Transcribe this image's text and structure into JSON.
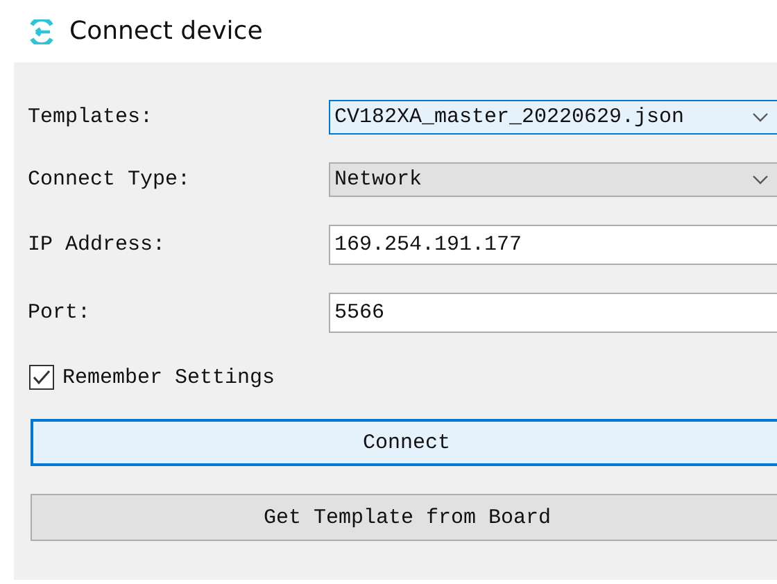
{
  "window": {
    "title": "Connect device"
  },
  "fields": [
    {
      "label": "Templates:",
      "kind": "combo",
      "value": "CV182XA_master_20220629.json",
      "focused": true
    },
    {
      "label": "Connect Type:",
      "kind": "combo",
      "value": "Network",
      "focused": false
    },
    {
      "label": "IP Address:",
      "kind": "input",
      "value": "169.254.191.177",
      "focused": false
    },
    {
      "label": "Port:",
      "kind": "input",
      "value": "5566",
      "focused": false
    }
  ],
  "remember": {
    "label": "Remember Settings",
    "checked": true
  },
  "buttons": [
    {
      "label": "Connect",
      "focused": true
    },
    {
      "label": "Get Template from Board",
      "focused": false
    }
  ]
}
